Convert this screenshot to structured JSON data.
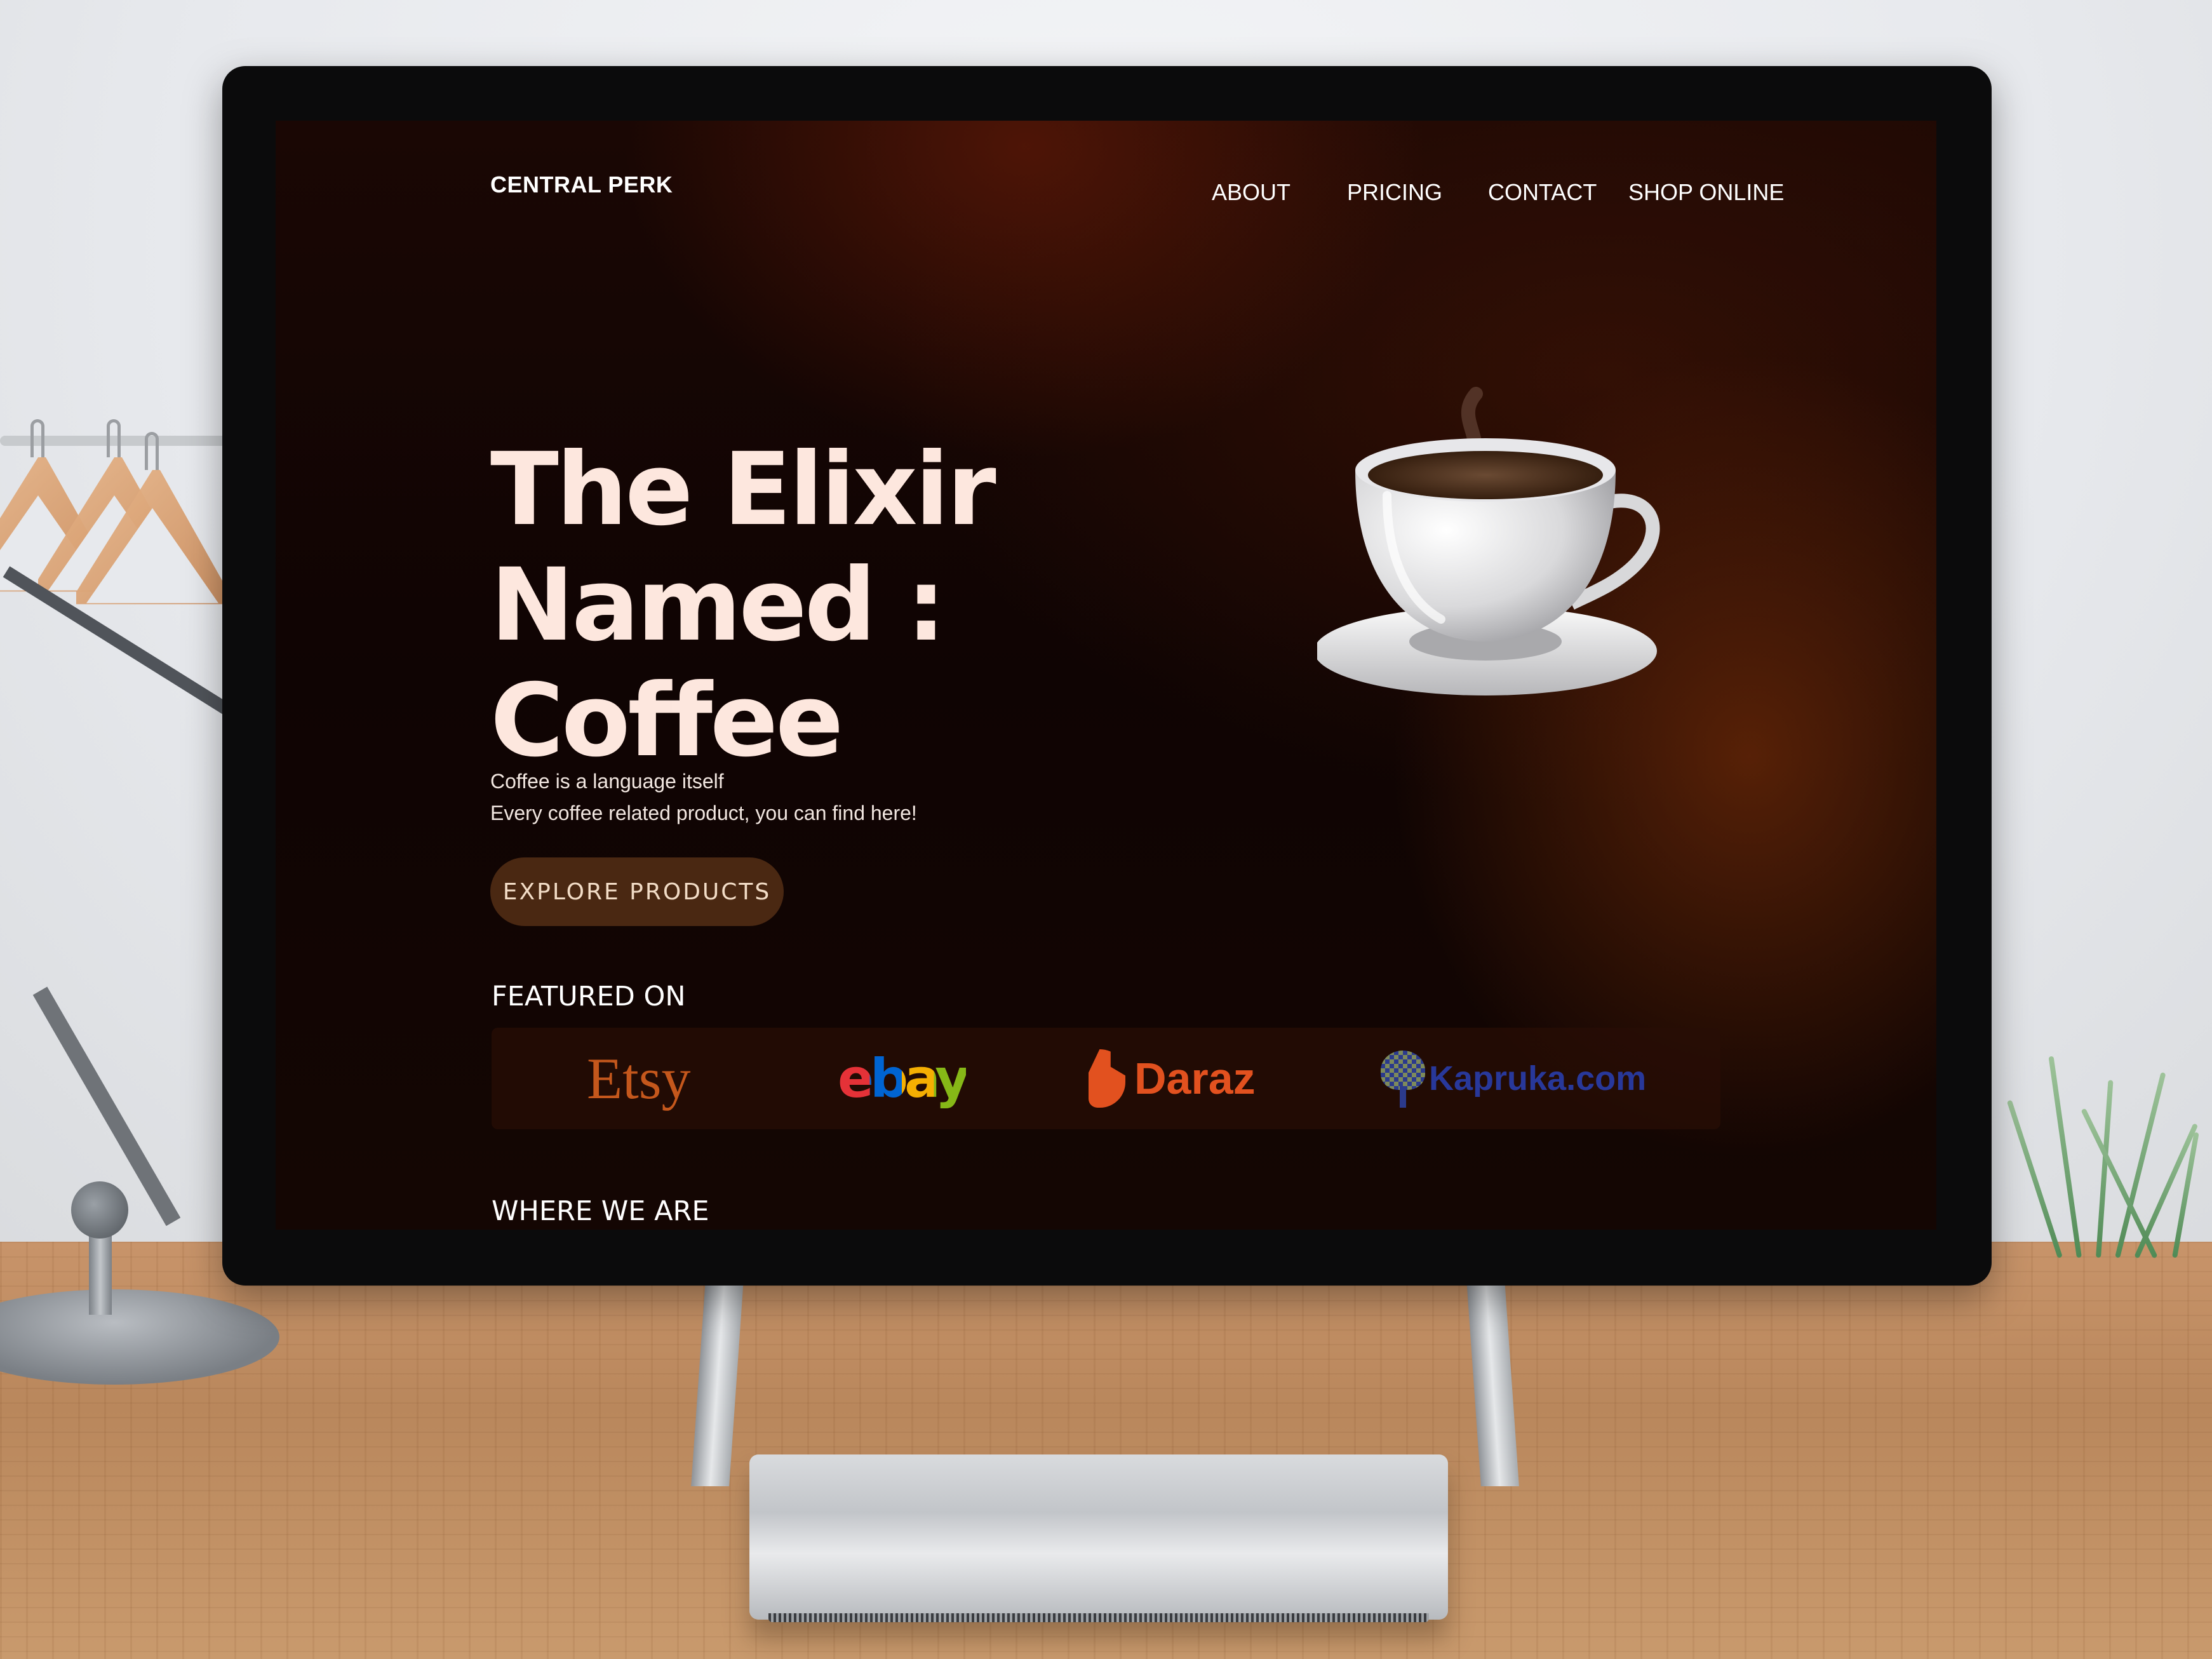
{
  "site": {
    "brand": "CENTRAL PERK",
    "nav": [
      {
        "label": "ABOUT"
      },
      {
        "label": "PRICING"
      },
      {
        "label": "CONTACT"
      },
      {
        "label": "SHOP ONLINE"
      }
    ],
    "hero": {
      "title_line1": "The Elixir",
      "title_line2": "Named : Coffee",
      "subtitle_line1": "Coffee is a language itself",
      "subtitle_line2": "Every coffee related product, you can find here!",
      "cta_label": "EXPLORE PRODUCTS"
    },
    "featured": {
      "heading": "FEATURED ON",
      "logos": [
        {
          "name": "Etsy",
          "icon": "etsy-logo"
        },
        {
          "name": "ebay",
          "icon": "ebay-logo"
        },
        {
          "name": "Daraz",
          "icon": "daraz-logo"
        },
        {
          "name": "Kapruka.com",
          "icon": "kapruka-logo"
        }
      ]
    },
    "where": {
      "heading": "WHERE WE ARE"
    }
  },
  "colors": {
    "background_dark": "#0f0403",
    "accent_glow": "#6e2a08",
    "hero_text": "#fde7de",
    "cta_bg": "#4a2812",
    "cta_text": "#f2dcc6"
  }
}
